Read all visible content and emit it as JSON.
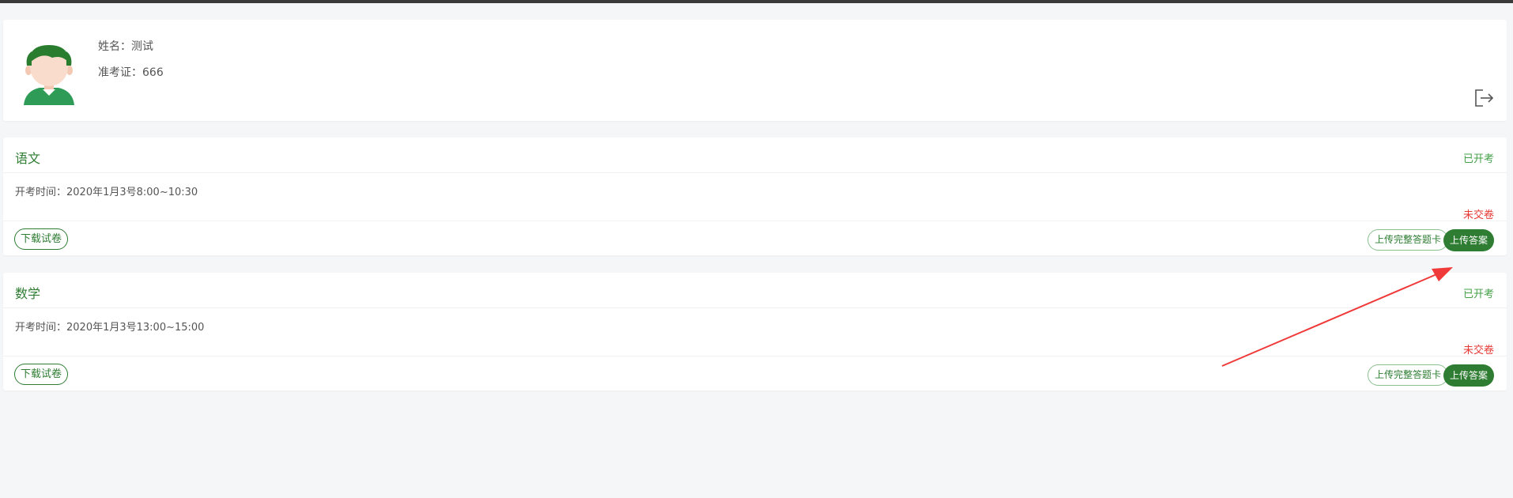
{
  "user": {
    "name_line": "姓名：测试",
    "ticket_line": "准考证：666"
  },
  "icons": {
    "avatar": "avatar-illustration",
    "logout": "logout-icon",
    "annotation": "red-arrow"
  },
  "colors": {
    "primary_green": "#2e7d32",
    "status_green": "#43a047",
    "alert_red": "#e53935",
    "background": "#f5f6f8"
  },
  "exams": [
    {
      "subject": "语文",
      "status": "已开考",
      "time": "开考时间：2020年1月3号8:00~10:30",
      "submission": "未交卷",
      "download_label": "下载试卷",
      "upload_card_label": "上传完整答题卡",
      "upload_answer_label": "上传答案"
    },
    {
      "subject": "数学",
      "status": "已开考",
      "time": "开考时间：2020年1月3号13:00~15:00",
      "submission": "未交卷",
      "download_label": "下载试卷",
      "upload_card_label": "上传完整答题卡",
      "upload_answer_label": "上传答案"
    }
  ]
}
